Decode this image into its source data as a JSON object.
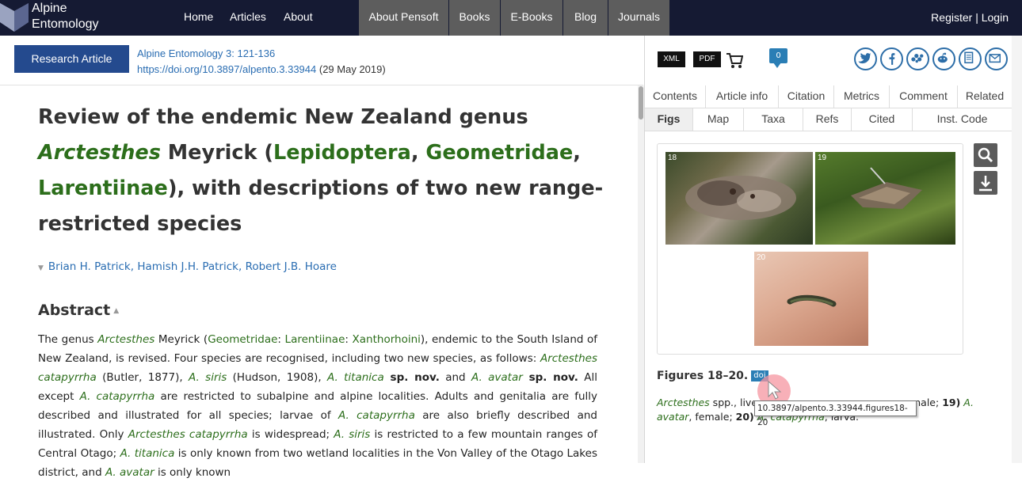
{
  "header": {
    "logo_line1": "Alpine",
    "logo_line2": "Entomology",
    "nav": [
      "Home",
      "Articles",
      "About"
    ],
    "nav_gray": [
      "About Pensoft",
      "Books",
      "E-Books",
      "Blog",
      "Journals"
    ],
    "register": "Register",
    "separator": "|",
    "login": "Login"
  },
  "article": {
    "type_badge": "Research Article",
    "journal_ref": "Alpine Entomology 3: 121-136",
    "doi_link": "https://doi.org/10.3897/alpento.3.33944",
    "date": "(29 May 2019)",
    "title_parts": {
      "p1": "Review of the endemic New Zealand genus",
      "genus": "Arctesthes",
      "p2": " Meyrick (",
      "order": "Lepidoptera",
      "comma1": ", ",
      "family": "Geometridae",
      "comma2": ",",
      "subfamily": "Larentiinae",
      "p3": "), with descriptions of two new range-restricted species"
    },
    "authors": [
      "Brian H. Patrick",
      "Hamish J.H. Patrick",
      "Robert J.B. Hoare"
    ],
    "abstract_heading": "Abstract",
    "abstract": {
      "a1": "The genus ",
      "a2": "Arctesthes",
      "a3": " Meyrick (",
      "a4": "Geometridae",
      "a5": ": ",
      "a6": "Larentiinae",
      "a7": ": ",
      "a8": "Xanthorhoini",
      "a9": "), endemic to the South Island of New Zealand, is revised. Four species are recognised, including two new species, as follows: ",
      "a10": "Arctesthes catapyrrha",
      "a11": " (Butler, 1877), ",
      "a12": "A. siris",
      "a13": " (Hudson, 1908), ",
      "a14": "A. titanica",
      "a15": " sp. nov.",
      "a16": " and ",
      "a17": "A. avatar",
      "a18": " sp. nov.",
      "a19": " All except ",
      "a20": "A. catapyrrha",
      "a21": " are restricted to subalpine and alpine localities. Adults and genitalia are fully described and illustrated for all species; larvae of ",
      "a22": "A. catapyrrha",
      "a23": " are also briefly described and illustrated. Only ",
      "a24": "Arctesthes catapyrrha",
      "a25": " is widespread; ",
      "a26": "A. siris",
      "a27": " is restricted to a few mountain ranges of Central Otago; ",
      "a28": "A. titanica",
      "a29": " is only known from two wetland localities in the Von Valley of the Otago Lakes district, and ",
      "a30": "A. avatar",
      "a31": " is only known"
    }
  },
  "sidebar": {
    "downloads": [
      "XML",
      "PDF"
    ],
    "comment_count": "0",
    "social_icons": [
      "twitter-icon",
      "facebook-icon",
      "mendeley-icon",
      "reddit-icon",
      "print-icon",
      "email-icon"
    ],
    "tabs_row1": [
      "Contents",
      "Article info",
      "Citation",
      "Metrics",
      "Comment",
      "Related"
    ],
    "tabs_row2": [
      "Figs",
      "Map",
      "Taxa",
      "Refs",
      "Cited",
      "Inst. Code"
    ],
    "figure_numbers": [
      "18",
      "19",
      "20"
    ],
    "figure_title": "Figures 18–20.",
    "doi_badge": "doi",
    "caption": {
      "c1": "Arctesthes",
      "c2": " spp., live",
      "c3": " male; ",
      "c4": "19)",
      "c5": " A. avatar",
      "c6": ", female; ",
      "c7": "20)",
      "c8": " A. catapyrrha",
      "c9": ", larva."
    },
    "tooltip": "10.3897/alpento.3.33944.figures18-20"
  },
  "colors": {
    "header_bg": "#151a33",
    "accent_blue": "#244a8e",
    "link_blue": "#2a6db2",
    "taxon_green": "#2c6e1b"
  }
}
